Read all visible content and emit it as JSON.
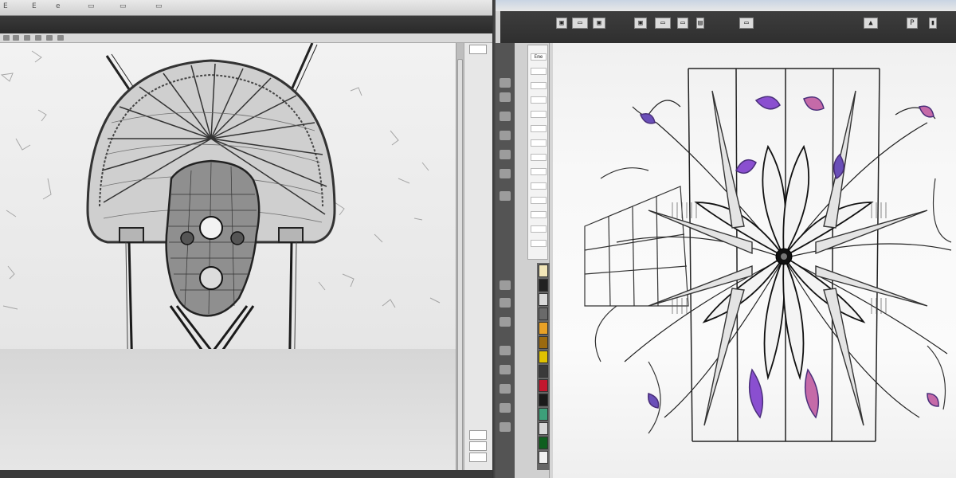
{
  "left_window": {
    "title_fragments": [
      "E",
      "E",
      "e",
      "▭",
      "▭",
      "▭"
    ],
    "side_labels": [
      "",
      "",
      "",
      "",
      ""
    ],
    "canvas_subject": "wireframe-robot-figure"
  },
  "right_window": {
    "toolbar_buttons": [
      "▣",
      "▭",
      "▣",
      "▣",
      "▭",
      "▭",
      "▤",
      "▭",
      "▲",
      "P",
      "▮"
    ],
    "panel_items": [
      "Eme",
      "",
      "",
      "",
      "",
      "",
      "",
      "",
      "",
      "",
      "",
      "",
      "",
      ""
    ],
    "swatch_colors": [
      "#f2e6b8",
      "#222222",
      "#d9d9d9",
      "#6a6a6a",
      "#e8a126",
      "#9b6a10",
      "#e0c200",
      "#3a3a3a",
      "#c2182e",
      "#1a1a1a",
      "#3da07a",
      "#d8d8d8",
      "#0f5f1f",
      "#f0f0f0"
    ],
    "canvas_subject": "symmetric-flower-wireframe",
    "accent_colors": [
      "#8a4fd0",
      "#c56aa8",
      "#6a4fb8"
    ]
  }
}
